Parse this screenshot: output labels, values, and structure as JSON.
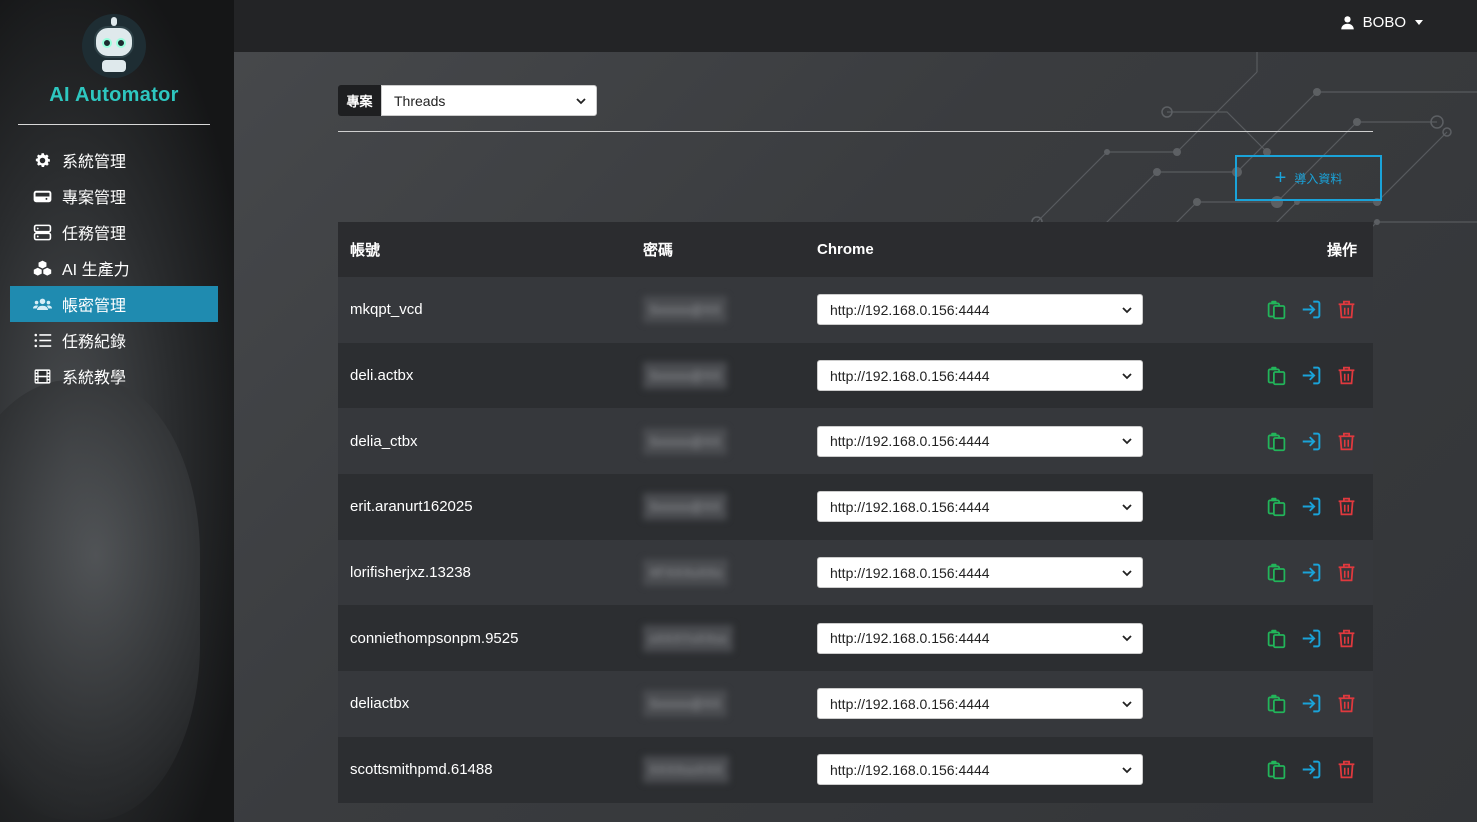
{
  "app": {
    "brand": "AI Automator"
  },
  "sidebar": {
    "items": [
      {
        "label": "系統管理",
        "icon": "gear-icon",
        "active": false
      },
      {
        "label": "專案管理",
        "icon": "hdd-icon",
        "active": false
      },
      {
        "label": "任務管理",
        "icon": "server-icon",
        "active": false
      },
      {
        "label": "AI 生產力",
        "icon": "cubes-icon",
        "active": false
      },
      {
        "label": "帳密管理",
        "icon": "users-icon",
        "active": true
      },
      {
        "label": "任務紀錄",
        "icon": "list-icon",
        "active": false
      },
      {
        "label": "系統教學",
        "icon": "film-icon",
        "active": false
      }
    ]
  },
  "topbar": {
    "user": "BOBO"
  },
  "project": {
    "label": "專案",
    "selected": "Threads"
  },
  "import_button": {
    "label": "導入資料"
  },
  "table": {
    "headers": {
      "account": "帳號",
      "password": "密碼",
      "chrome": "Chrome",
      "actions": "操作"
    },
    "rows": [
      {
        "account": "mkqpt_vcd",
        "password": "Sxxxxx@XX",
        "chrome": "http://192.168.0.156:4444"
      },
      {
        "account": "deli.actbx",
        "password": "Sxxxxx@XX",
        "chrome": "http://192.168.0.156:4444"
      },
      {
        "account": "delia_ctbx",
        "password": "Sxxxxx@XX",
        "chrome": "http://192.168.0.156:4444"
      },
      {
        "account": "erit.aranurt162025",
        "password": "Sxxxxx@XX",
        "chrome": "http://192.168.0.156:4444"
      },
      {
        "account": "lorifisherjxz.13238",
        "password": "XFXXXxXXx",
        "chrome": "http://192.168.0.156:4444"
      },
      {
        "account": "conniethompsonpm.9525",
        "password": "xXXXYxXXxx",
        "chrome": "http://192.168.0.156:4444"
      },
      {
        "account": "deliactbx",
        "password": "Sxxxxx@XX",
        "chrome": "http://192.168.0.156:4444"
      },
      {
        "account": "scottsmithpmd.61488",
        "password": "XXXXxxXXX",
        "chrome": "http://192.168.0.156:4444"
      }
    ]
  },
  "colors": {
    "accent": "#1f8bb0",
    "brand": "#2ec7c0",
    "copy": "#22b55a",
    "login": "#1aa3d9",
    "delete": "#e0393e"
  }
}
